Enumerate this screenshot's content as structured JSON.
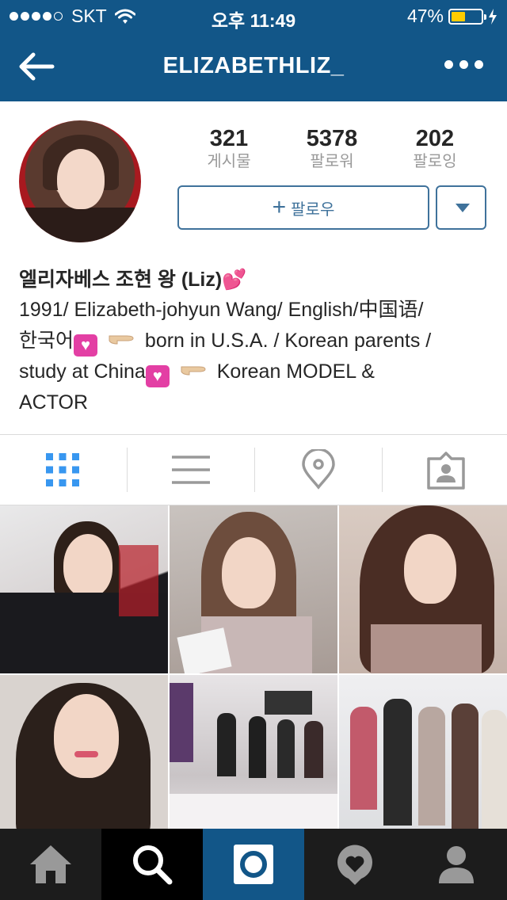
{
  "status_bar": {
    "carrier": "SKT",
    "time": "오후 11:49",
    "battery_percent": "47%",
    "battery_level": 0.47,
    "signal_bars_filled": 4,
    "signal_bars_total": 5,
    "icons": [
      "wifi-icon",
      "battery-icon",
      "charging-bolt-icon"
    ]
  },
  "nav": {
    "title": "ELIZABETHLIZ_",
    "back_icon": "back-arrow-icon",
    "more_icon": "more-options-icon"
  },
  "profile": {
    "stats": [
      {
        "value": "321",
        "label": "게시물"
      },
      {
        "value": "5378",
        "label": "팔로워"
      },
      {
        "value": "202",
        "label": "팔로잉"
      }
    ],
    "follow_label": "팔로우",
    "name": "엘리자베스 조현 왕 (Liz)",
    "bio": {
      "line1": "1991/ Elizabeth-johyun Wang/ English/中国语/",
      "line2_a": "한국어",
      "line2_b": "born in U.S.A. / Korean parents /",
      "line3_a": "study at China",
      "line3_b": "Korean MODEL &",
      "line4": "ACTOR"
    },
    "emoji": {
      "name_trailing": "💕",
      "heart_box": "💟",
      "pointing_hand": "👉"
    }
  },
  "view_tabs": [
    {
      "icon": "grid-icon",
      "active": true
    },
    {
      "icon": "list-icon",
      "active": false
    },
    {
      "icon": "location-pin-icon",
      "active": false
    },
    {
      "icon": "tagged-user-icon",
      "active": false
    }
  ],
  "tab_bar": [
    {
      "icon": "home-icon",
      "active": false
    },
    {
      "icon": "search-icon",
      "active": false
    },
    {
      "icon": "camera-icon",
      "active": true
    },
    {
      "icon": "activity-heart-icon",
      "active": false
    },
    {
      "icon": "profile-icon",
      "active": false
    }
  ],
  "colors": {
    "brand": "#125688",
    "button_border": "#3f729b",
    "active_tab_icon": "#3897f0",
    "inactive_icon": "#999999",
    "text": "#262626"
  }
}
